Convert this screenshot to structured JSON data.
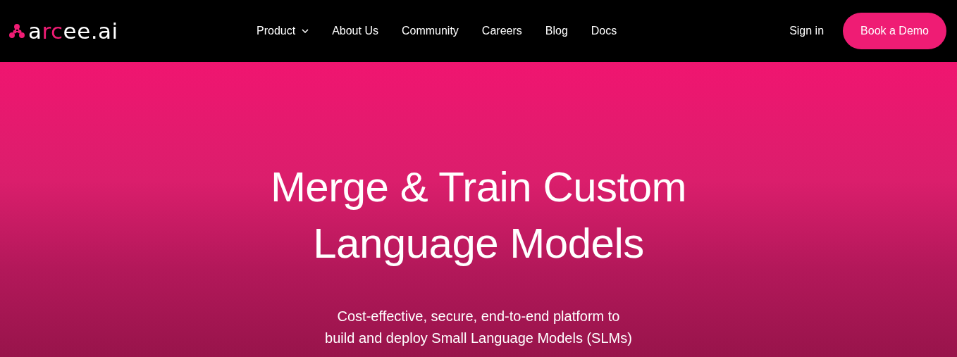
{
  "logo": {
    "parts": [
      {
        "text": "a",
        "accent": false
      },
      {
        "text": "rc",
        "accent": true
      },
      {
        "text": "ee.ai",
        "accent": false
      }
    ]
  },
  "nav": [
    {
      "label": "Product",
      "dropdown": true
    },
    {
      "label": "About Us",
      "dropdown": false
    },
    {
      "label": "Community",
      "dropdown": false
    },
    {
      "label": "Careers",
      "dropdown": false
    },
    {
      "label": "Blog",
      "dropdown": false
    },
    {
      "label": "Docs",
      "dropdown": false
    }
  ],
  "sign_in": "Sign in",
  "cta": "Book a Demo",
  "hero": {
    "title": "Merge & Train Custom Language Models",
    "subtitle": [
      "Cost-effective, secure, end-to-end platform to",
      "build and deploy Small Language Models (SLMs)"
    ]
  }
}
